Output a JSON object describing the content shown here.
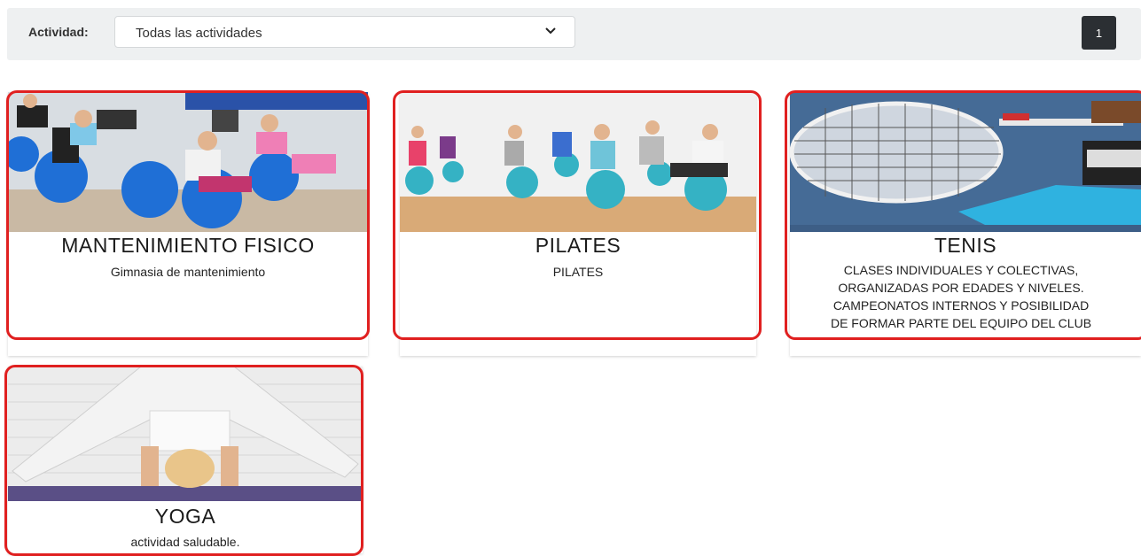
{
  "filter": {
    "label": "Actividad:",
    "selected": "Todas las actividades"
  },
  "pagination": {
    "current": "1"
  },
  "cards": [
    {
      "title": "MANTENIMIENTO FISICO",
      "description": "Gimnasia de mantenimiento"
    },
    {
      "title": "PILATES",
      "description": "PILATES"
    },
    {
      "title": "TENIS",
      "description_lines": [
        "CLASES INDIVIDUALES Y COLECTIVAS,",
        "ORGANIZADAS POR EDADES Y NIVELES.",
        "CAMPEONATOS INTERNOS Y POSIBILIDAD",
        "DE FORMAR PARTE DEL EQUIPO DEL CLUB"
      ]
    },
    {
      "title": "YOGA",
      "description": "actividad saludable."
    }
  ],
  "colors": {
    "highlight": "#e02020",
    "pagination_bg": "#2b2f33",
    "filter_bg": "#eef0f1"
  },
  "icons": {
    "select": "chevron-down-icon"
  }
}
